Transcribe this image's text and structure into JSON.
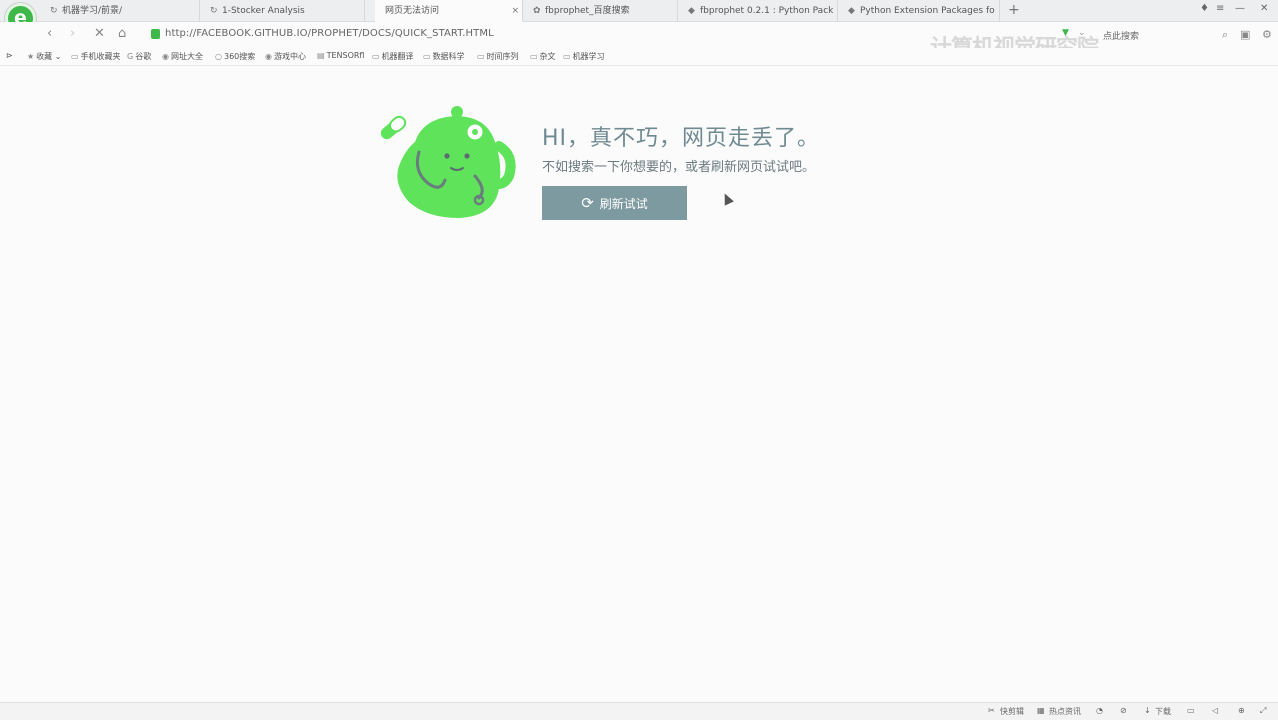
{
  "tabs": [
    {
      "label": "机器学习/前景/",
      "icon": "reload-icon"
    },
    {
      "label": "1-Stocker Analysis",
      "icon": "reload-icon"
    },
    {
      "label": "网页无法访问",
      "icon": ""
    },
    {
      "label": "fbprophet_百度搜索",
      "icon": "paw-icon"
    },
    {
      "label": "fbprophet 0.2.1 : Python Pack",
      "icon": "python-icon"
    },
    {
      "label": "Python Extension Packages fo",
      "icon": "python-icon"
    }
  ],
  "tab_close": "×",
  "new_tab": "+",
  "logo_letter": "e",
  "address": {
    "url": "http://FACEBOOK.GITHUB.IO/PROPHET/DOCS/QUICK_START.HTML",
    "search_label": "点此搜索"
  },
  "watermark": "计算机视觉研究院",
  "bookmarks": [
    {
      "label": "收藏"
    },
    {
      "label": "手机收藏夹"
    },
    {
      "label": "谷歌"
    },
    {
      "label": "网址大全"
    },
    {
      "label": "360搜索"
    },
    {
      "label": "游戏中心"
    },
    {
      "label": "TENSORfl"
    },
    {
      "label": "机器翻译"
    },
    {
      "label": "数据科学"
    },
    {
      "label": "时间序列"
    },
    {
      "label": "杂文"
    },
    {
      "label": "机器学习"
    }
  ],
  "error": {
    "title": "HI，真不巧，网页走丢了。",
    "subtitle": "不如搜索一下你想要的，或者刷新网页试试吧。",
    "button_label": "刷新试试"
  },
  "status": {
    "left": "",
    "items": [
      "快剪辑",
      "热点资讯",
      "下载"
    ]
  },
  "colors": {
    "accent": "#3fb84a",
    "mascot": "#5ee35a",
    "button": "#7d9aa0",
    "title": "#6f8a92"
  }
}
